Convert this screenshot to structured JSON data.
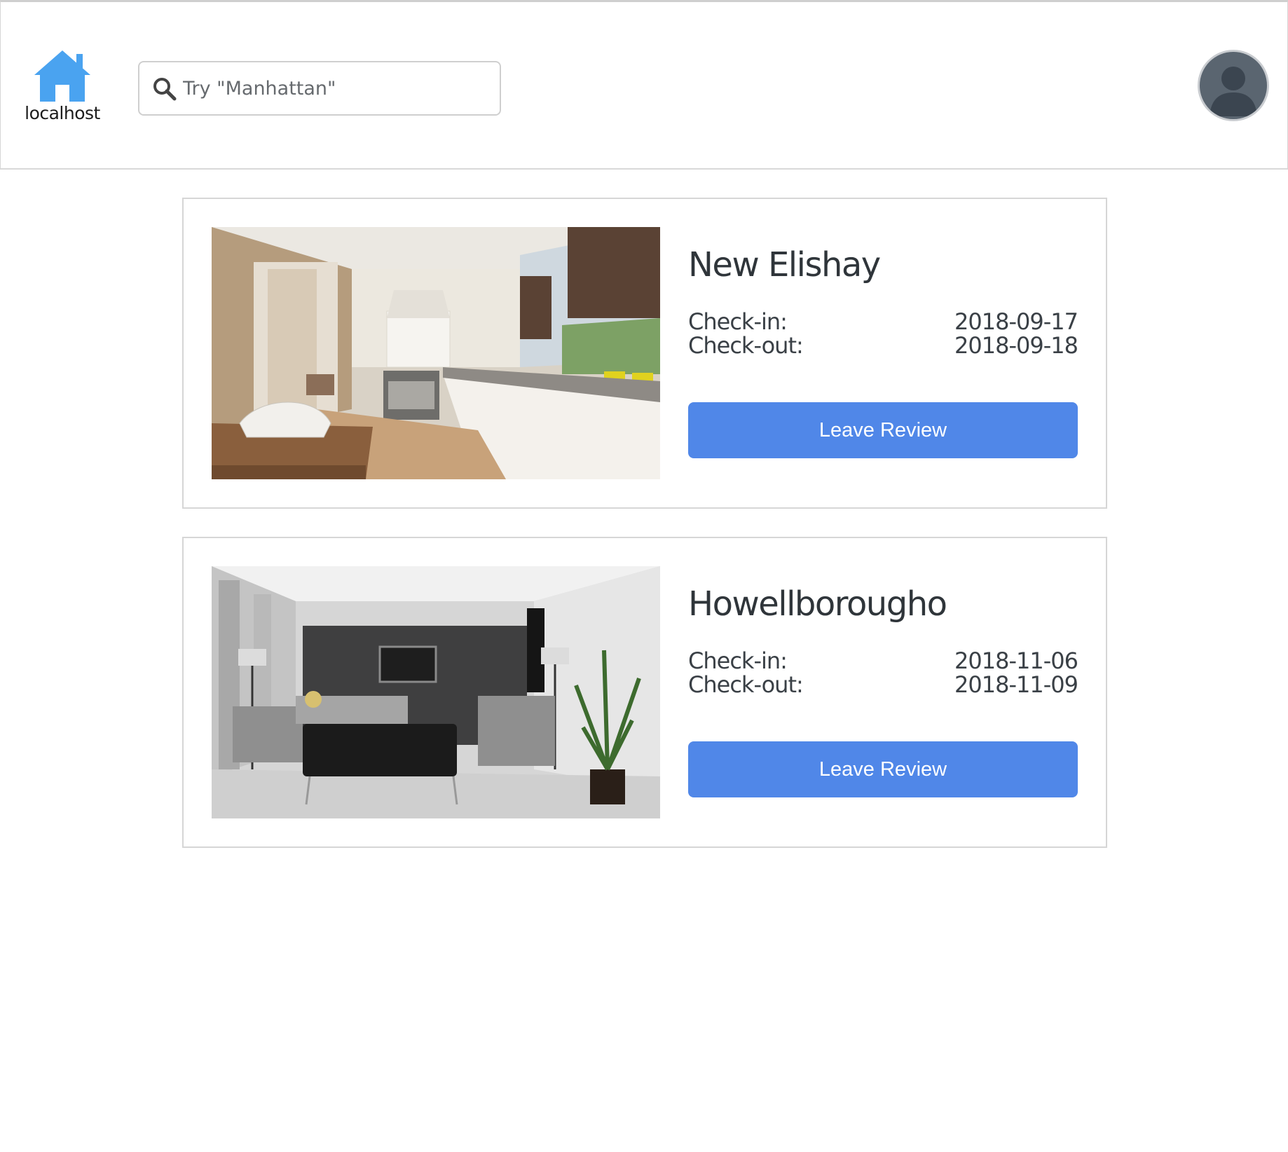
{
  "brand": {
    "name": "localhost",
    "icon": "house-icon",
    "color": "#4aa3f0"
  },
  "search": {
    "placeholder": "Try \"Manhattan\"",
    "value": "",
    "icon": "search-icon"
  },
  "user": {
    "avatar_icon": "user-silhouette-icon"
  },
  "bookings": [
    {
      "title": "New Elishay",
      "photo": "kitchen-photo",
      "checkin_label": "Check-in:",
      "checkin": "2018-09-17",
      "checkout_label": "Check-out:",
      "checkout": "2018-09-18",
      "button": "Leave Review"
    },
    {
      "title": "Howellborougho",
      "photo": "living-room-photo",
      "checkin_label": "Check-in:",
      "checkin": "2018-11-06",
      "checkout_label": "Check-out:",
      "checkout": "2018-11-09",
      "button": "Leave Review"
    }
  ],
  "colors": {
    "accent": "#5087e8",
    "border": "#d6d6d6",
    "text": "#333a40"
  }
}
